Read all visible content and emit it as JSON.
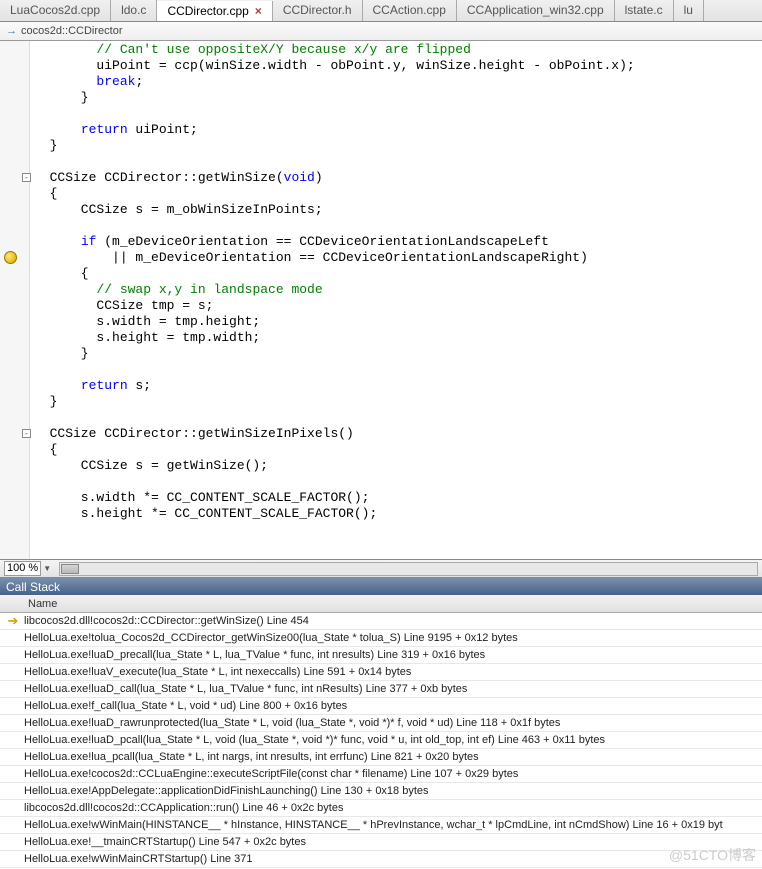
{
  "tabs": [
    {
      "label": "LuaCocos2d.cpp",
      "active": false
    },
    {
      "label": "ldo.c",
      "active": false
    },
    {
      "label": "CCDirector.cpp",
      "active": true
    },
    {
      "label": "CCDirector.h",
      "active": false
    },
    {
      "label": "CCAction.cpp",
      "active": false
    },
    {
      "label": "CCApplication_win32.cpp",
      "active": false
    },
    {
      "label": "lstate.c",
      "active": false
    },
    {
      "label": "lu",
      "active": false
    }
  ],
  "breadcrumb": "cocos2d::CCDirector",
  "code_lines": [
    {
      "indent": 8,
      "tokens": [
        {
          "t": "// Can't use oppositeX/Y because x/y are flipped",
          "c": "cm"
        }
      ]
    },
    {
      "indent": 8,
      "tokens": [
        {
          "t": "uiPoint = ccp(winSize.width - obPoint.y, winSize.height - obPoint.x);"
        }
      ]
    },
    {
      "indent": 8,
      "tokens": [
        {
          "t": "break",
          "c": "kw"
        },
        {
          "t": ";"
        }
      ]
    },
    {
      "indent": 6,
      "tokens": [
        {
          "t": "}"
        }
      ]
    },
    {
      "indent": 0,
      "tokens": []
    },
    {
      "indent": 6,
      "tokens": [
        {
          "t": "return",
          "c": "kw"
        },
        {
          "t": " uiPoint;"
        }
      ]
    },
    {
      "indent": 2,
      "tokens": [
        {
          "t": "}"
        }
      ]
    },
    {
      "indent": 0,
      "tokens": []
    },
    {
      "indent": 2,
      "fold": true,
      "tokens": [
        {
          "t": "CCSize CCDirector::getWinSize("
        },
        {
          "t": "void",
          "c": "ty"
        },
        {
          "t": ")"
        }
      ]
    },
    {
      "indent": 2,
      "tokens": [
        {
          "t": "{"
        }
      ]
    },
    {
      "indent": 6,
      "tokens": [
        {
          "t": "CCSize s = m_obWinSizeInPoints;"
        }
      ]
    },
    {
      "indent": 0,
      "tokens": []
    },
    {
      "indent": 6,
      "tokens": [
        {
          "t": "if",
          "c": "kw"
        },
        {
          "t": " (m_eDeviceOrientation == CCDeviceOrientationLandscapeLeft"
        }
      ]
    },
    {
      "indent": 10,
      "bp": true,
      "tokens": [
        {
          "t": "|| m_eDeviceOrientation == CCDeviceOrientationLandscapeRight)"
        }
      ]
    },
    {
      "indent": 6,
      "tokens": [
        {
          "t": "{"
        }
      ]
    },
    {
      "indent": 8,
      "tokens": [
        {
          "t": "// swap x,y in landspace mode",
          "c": "cm"
        }
      ]
    },
    {
      "indent": 8,
      "tokens": [
        {
          "t": "CCSize tmp = s;"
        }
      ]
    },
    {
      "indent": 8,
      "tokens": [
        {
          "t": "s.width = tmp.height;"
        }
      ]
    },
    {
      "indent": 8,
      "tokens": [
        {
          "t": "s.height = tmp.width;"
        }
      ]
    },
    {
      "indent": 6,
      "tokens": [
        {
          "t": "}"
        }
      ]
    },
    {
      "indent": 0,
      "tokens": []
    },
    {
      "indent": 6,
      "tokens": [
        {
          "t": "return",
          "c": "kw"
        },
        {
          "t": " s;"
        }
      ]
    },
    {
      "indent": 2,
      "tokens": [
        {
          "t": "}"
        }
      ]
    },
    {
      "indent": 0,
      "tokens": []
    },
    {
      "indent": 2,
      "fold": true,
      "tokens": [
        {
          "t": "CCSize CCDirector::getWinSizeInPixels()"
        }
      ]
    },
    {
      "indent": 2,
      "tokens": [
        {
          "t": "{"
        }
      ]
    },
    {
      "indent": 6,
      "tokens": [
        {
          "t": "CCSize s = getWinSize();"
        }
      ]
    },
    {
      "indent": 0,
      "tokens": []
    },
    {
      "indent": 6,
      "tokens": [
        {
          "t": "s.width *= CC_CONTENT_SCALE_FACTOR();"
        }
      ]
    },
    {
      "indent": 6,
      "tokens": [
        {
          "t": "s.height *= CC_CONTENT_SCALE_FACTOR();"
        }
      ]
    },
    {
      "indent": 0,
      "tokens": []
    }
  ],
  "zoom_level": "100 %",
  "callstack_title": "Call Stack",
  "callstack_header": "Name",
  "callstack": [
    {
      "current": true,
      "text": "libcocos2d.dll!cocos2d::CCDirector::getWinSize()  Line 454"
    },
    {
      "text": "HelloLua.exe!tolua_Cocos2d_CCDirector_getWinSize00(lua_State * tolua_S)  Line 9195 + 0x12 bytes"
    },
    {
      "text": "HelloLua.exe!luaD_precall(lua_State * L, lua_TValue * func, int nresults)  Line 319 + 0x16 bytes"
    },
    {
      "text": "HelloLua.exe!luaV_execute(lua_State * L, int nexeccalls)  Line 591 + 0x14 bytes"
    },
    {
      "text": "HelloLua.exe!luaD_call(lua_State * L, lua_TValue * func, int nResults)  Line 377 + 0xb bytes"
    },
    {
      "text": "HelloLua.exe!f_call(lua_State * L, void * ud)  Line 800 + 0x16 bytes"
    },
    {
      "text": "HelloLua.exe!luaD_rawrunprotected(lua_State * L, void (lua_State *, void *)* f, void * ud)  Line 118 + 0x1f bytes"
    },
    {
      "text": "HelloLua.exe!luaD_pcall(lua_State * L, void (lua_State *, void *)* func, void * u, int old_top, int ef)  Line 463 + 0x11 bytes"
    },
    {
      "text": "HelloLua.exe!lua_pcall(lua_State * L, int nargs, int nresults, int errfunc)  Line 821 + 0x20 bytes"
    },
    {
      "text": "HelloLua.exe!cocos2d::CCLuaEngine::executeScriptFile(const char * filename)  Line 107 + 0x29 bytes"
    },
    {
      "text": "HelloLua.exe!AppDelegate::applicationDidFinishLaunching()  Line 130 + 0x18 bytes"
    },
    {
      "text": "libcocos2d.dll!cocos2d::CCApplication::run()  Line 46 + 0x2c bytes"
    },
    {
      "text": "HelloLua.exe!wWinMain(HINSTANCE__ * hInstance, HINSTANCE__ * hPrevInstance, wchar_t * lpCmdLine, int nCmdShow)  Line 16 + 0x19 byt"
    },
    {
      "text": "HelloLua.exe!__tmainCRTStartup()  Line 547 + 0x2c bytes"
    },
    {
      "text": "HelloLua.exe!wWinMainCRTStartup()  Line 371"
    }
  ],
  "watermark": "@51CTO博客"
}
